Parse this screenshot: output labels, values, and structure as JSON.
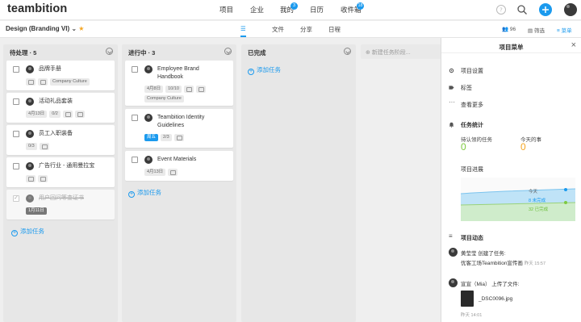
{
  "app": {
    "logo": "teambition"
  },
  "nav": {
    "items": [
      {
        "label": "项目"
      },
      {
        "label": "企业"
      },
      {
        "label": "我的",
        "badge": "3"
      },
      {
        "label": "日历"
      },
      {
        "label": "收件箱",
        "badge": "18"
      }
    ]
  },
  "project": {
    "title": "Design (Branding VI)",
    "tabs": [
      "☰",
      "文件",
      "分享",
      "日程"
    ],
    "member_count": "96",
    "filter_label": "筛选",
    "menu_label": "菜单"
  },
  "stages": [
    {
      "title": "待处理 · 5",
      "cards": [
        {
          "title": "品牌手册",
          "tags": [
            "Company Culture"
          ],
          "done": false
        },
        {
          "title": "活动礼品套装",
          "tags": [
            "4月13日",
            "0/2"
          ],
          "done": false
        },
        {
          "title": "员工入职装备",
          "tags": [
            "0/3"
          ],
          "done": false
        },
        {
          "title": "广告行业 - 通用曼拉宝",
          "tags": [],
          "done": false
        },
        {
          "title": "用户回问等查证书",
          "tags": [
            "1月11日"
          ],
          "done": true
        }
      ],
      "add_label": "添加任务"
    },
    {
      "title": "进行中 · 3",
      "cards": [
        {
          "title": "Employee Brand Handbook",
          "tags": [
            "4月8日",
            "10/10",
            "Company Culture"
          ],
          "done": false
        },
        {
          "title": "Teambition Identity Guidelines",
          "tags": [
            "周五",
            "2/3"
          ],
          "done": false
        },
        {
          "title": "Event Materials",
          "tags": [
            "4月13日"
          ],
          "done": false
        }
      ],
      "add_label": "添加任务"
    },
    {
      "title": "已完成",
      "cards": [],
      "add_label": "添加任务"
    }
  ],
  "new_stage": {
    "placeholder": "新建任务阶段..."
  },
  "panel": {
    "title": "项目菜单",
    "items": [
      "项目设置",
      "标签",
      "查看更多"
    ],
    "stats_title": "任务统计",
    "stat_pending_label": "待认领的任务",
    "stat_pending_value": "0",
    "stat_today_label": "今天的事",
    "stat_today_value": "0",
    "progress_title": "项目进展",
    "chart_legend": {
      "today": "今天",
      "incomplete": "8 未完成",
      "complete": "32 已完成"
    },
    "activity_title": "项目动态",
    "activities": [
      {
        "user": "黄莹莹",
        "action": "创建了任务:",
        "detail": "优客工场Teambition宣传画",
        "time": "昨天 15:57"
      },
      {
        "user": "宣宣（Mia）",
        "action": "上传了文件:",
        "detail": "_DSC0096.jpg",
        "time": "昨天 14:01"
      }
    ]
  },
  "colors": {
    "accent": "#1b9aee",
    "green": "#7ec940",
    "orange": "#f5a623"
  }
}
